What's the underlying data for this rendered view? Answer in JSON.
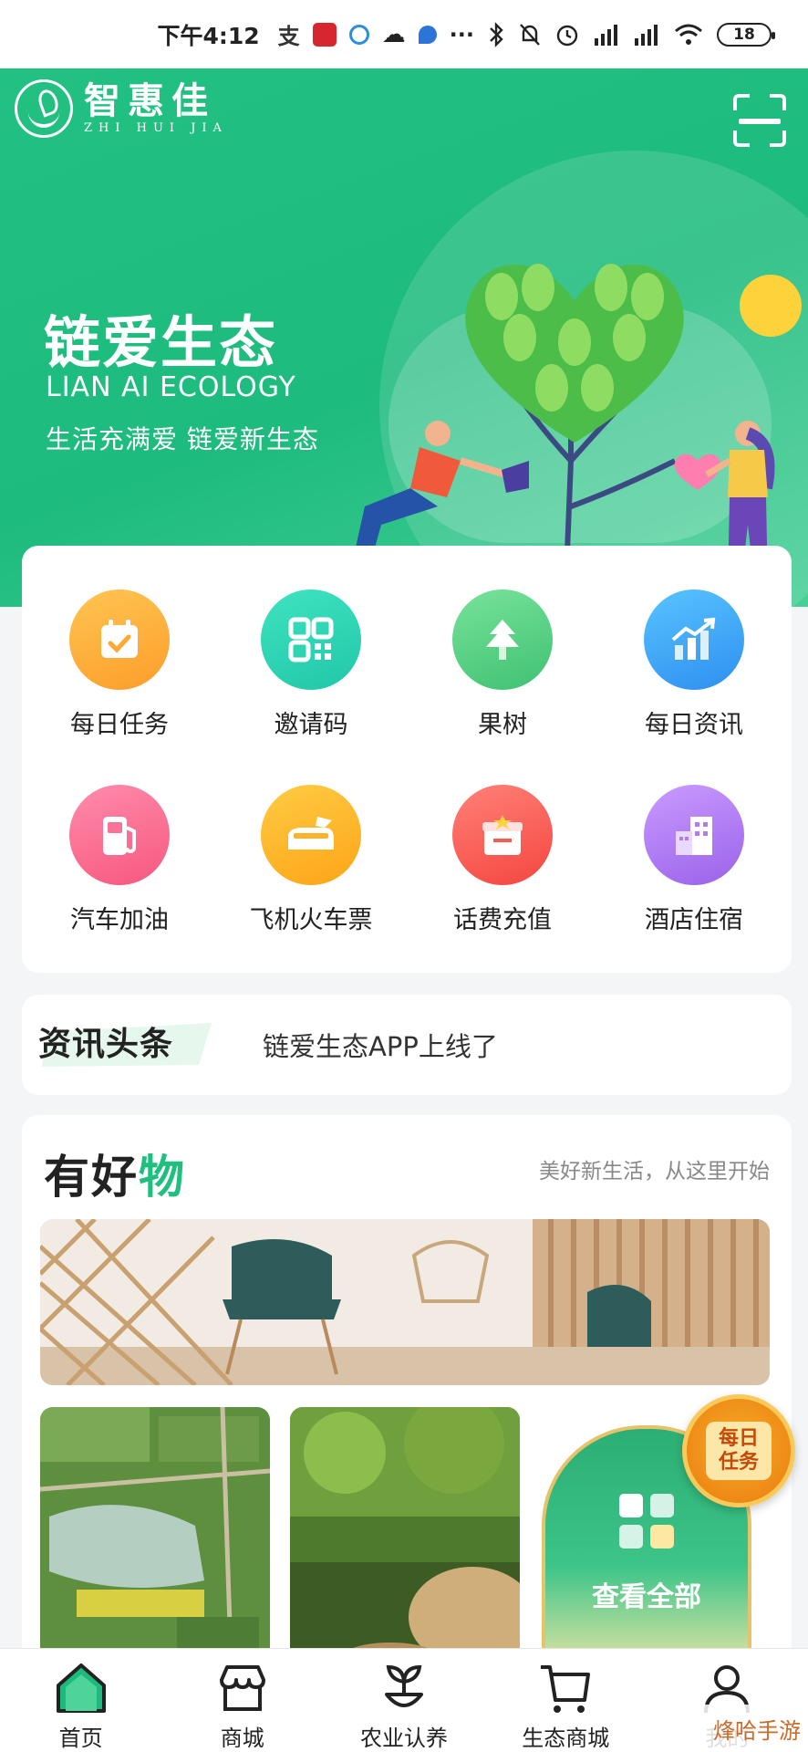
{
  "status_bar": {
    "time": "下午4:12",
    "battery": "18"
  },
  "header": {
    "logo_cn": "智惠佳",
    "logo_en": "ZHI HUI JIA"
  },
  "banner": {
    "title": "链爱生态",
    "subtitle_en": "LIAN AI ECOLOGY",
    "slogan": "生活充满爱 链爱新生态"
  },
  "functions": [
    {
      "label": "每日任务",
      "icon": "calendar-check-icon",
      "color": "#fdb03b"
    },
    {
      "label": "邀请码",
      "icon": "qr-code-icon",
      "color": "#2fd3b3"
    },
    {
      "label": "果树",
      "icon": "tree-icon",
      "color": "#5ccf86"
    },
    {
      "label": "每日资讯",
      "icon": "trend-chart-icon",
      "color": "#3aa7f5"
    },
    {
      "label": "汽车加油",
      "icon": "fuel-pump-icon",
      "color": "#fb6f94"
    },
    {
      "label": "飞机火车票",
      "icon": "plane-train-icon",
      "color": "#fdb72a"
    },
    {
      "label": "话费充值",
      "icon": "phone-recharge-icon",
      "color": "#fd6058"
    },
    {
      "label": "酒店住宿",
      "icon": "hotel-building-icon",
      "color": "#b07cf3"
    }
  ],
  "news": {
    "tag": "资讯头条",
    "headline": "链爱生态APP上线了"
  },
  "goods": {
    "title_prefix": "有好",
    "title_accent": "物",
    "subtitle": "美好新生活，从这里开始",
    "view_all": "查看全部"
  },
  "floating_task": {
    "line1": "每日",
    "line2": "任务"
  },
  "tabs": [
    {
      "label": "首页",
      "icon": "home-icon",
      "active": true
    },
    {
      "label": "商城",
      "icon": "store-icon"
    },
    {
      "label": "农业认养",
      "icon": "plant-sprout-icon"
    },
    {
      "label": "生态商城",
      "icon": "shopping-cart-icon"
    },
    {
      "label": "我的",
      "icon": "user-icon"
    }
  ],
  "watermark": "烽哈手游"
}
